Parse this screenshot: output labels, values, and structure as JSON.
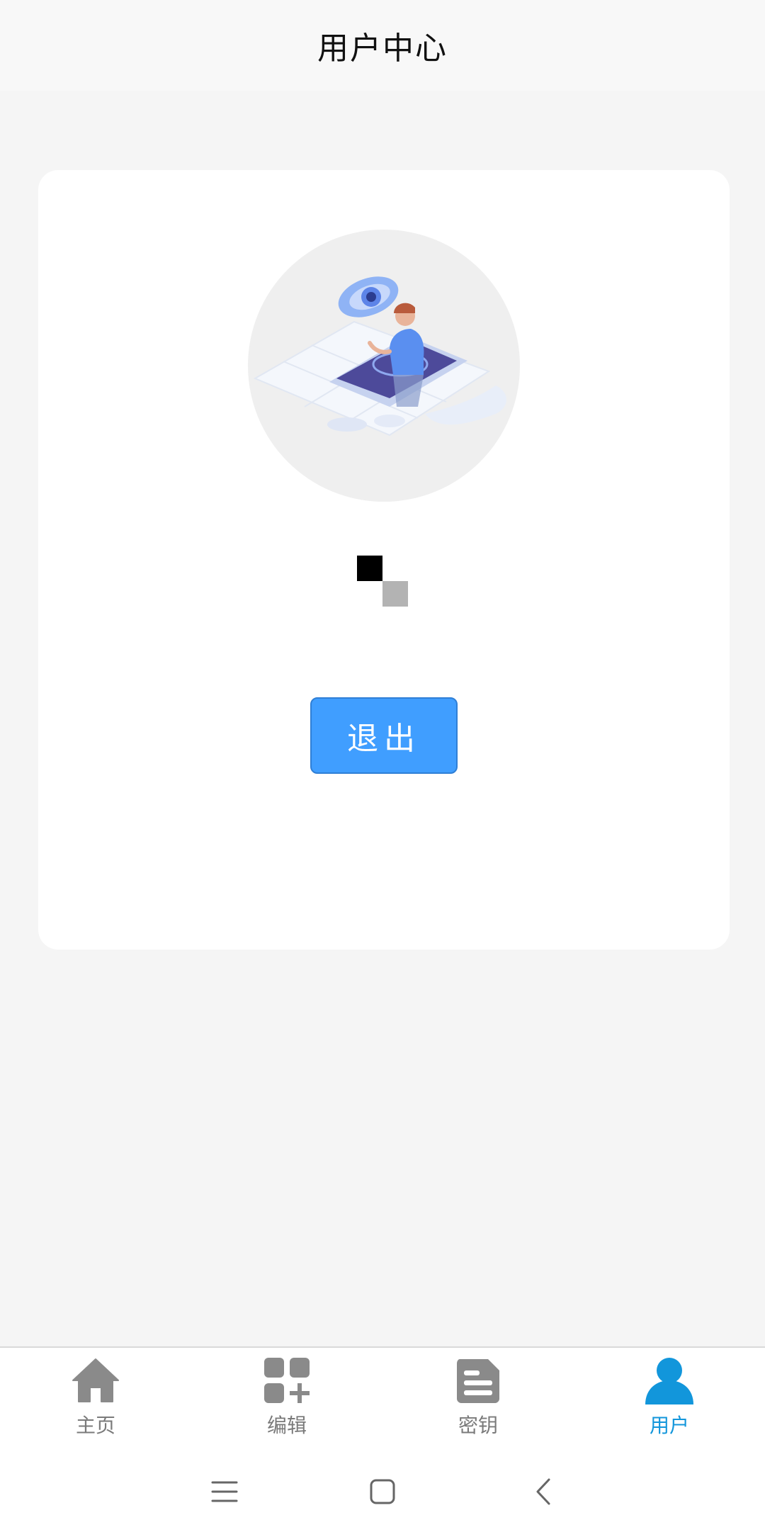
{
  "header": {
    "title": "用户中心"
  },
  "profile": {
    "logout_label": "退出"
  },
  "tabbar": {
    "items": [
      {
        "label": "主页",
        "icon": "home-icon",
        "active": false
      },
      {
        "label": "编辑",
        "icon": "edit-grid-icon",
        "active": false
      },
      {
        "label": "密钥",
        "icon": "key-document-icon",
        "active": false
      },
      {
        "label": "用户",
        "icon": "user-icon",
        "active": true
      }
    ]
  },
  "system_nav": {
    "items": [
      "menu-icon",
      "home-square-icon",
      "back-icon"
    ]
  },
  "colors": {
    "accent": "#1296db",
    "button": "#409eff",
    "inactive": "#7a7a7a",
    "background": "#f5f5f5"
  }
}
